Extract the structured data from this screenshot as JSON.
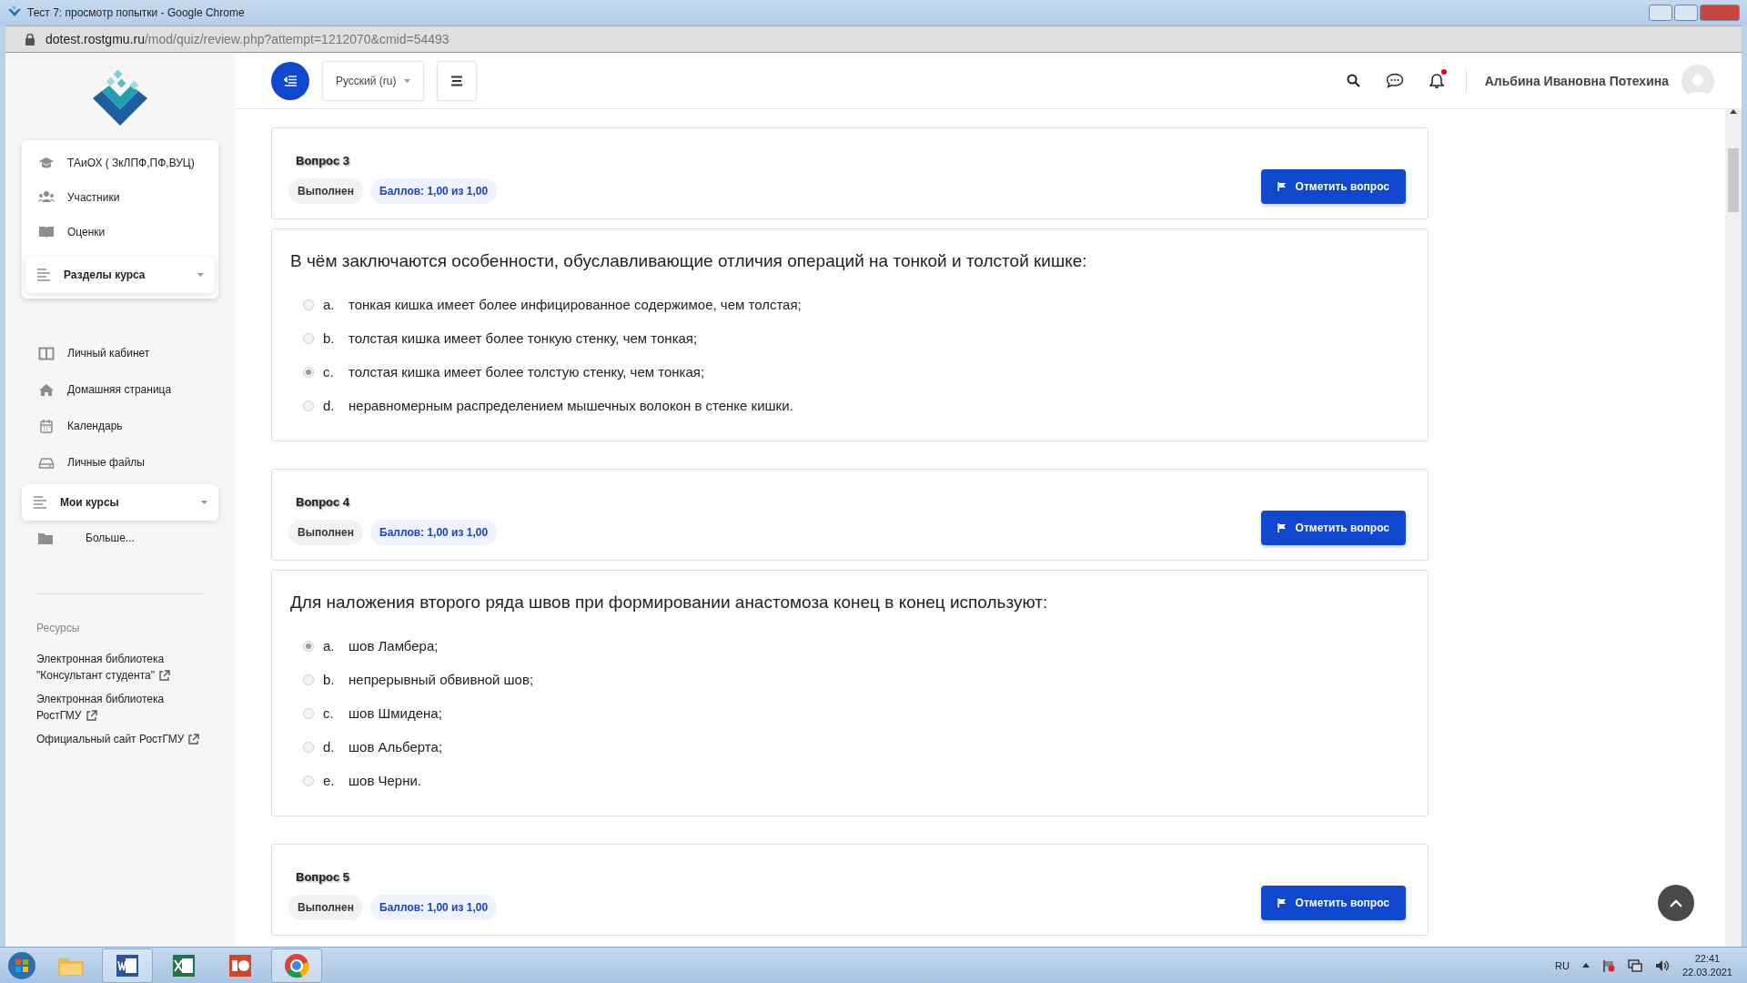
{
  "window": {
    "title": "Тест 7: просмотр попытки - Google Chrome"
  },
  "address_bar": {
    "host": "dotest.rostgmu.ru",
    "path": "/mod/quiz/review.php?attempt=1212070&cmid=54493"
  },
  "header": {
    "language": "Русский (ru)",
    "user_name": "Альбина Ивановна Потехина",
    "notification_unread": true
  },
  "sidebar": {
    "course_menu": [
      {
        "label": "ТАиОХ ( ЗкЛПФ,ПФ,ВУЦ)"
      },
      {
        "label": "Участники"
      },
      {
        "label": "Оценки"
      }
    ],
    "course_sections": {
      "label": "Разделы курса",
      "expanded": false
    },
    "nav": [
      {
        "label": "Личный кабинет"
      },
      {
        "label": "Домашняя страница"
      },
      {
        "label": "Календарь"
      },
      {
        "label": "Личные файлы"
      }
    ],
    "my_courses": {
      "label": "Мои курсы",
      "expanded": false
    },
    "more": {
      "label": "Больше..."
    },
    "resources": {
      "heading": "Ресурсы",
      "links": [
        "Электронная библиотека \"Консультант студента\"",
        "Электронная библиотека РостГМУ",
        "Официальный сайт РостГМУ"
      ]
    }
  },
  "questions": [
    {
      "title": "Вопрос 3",
      "status": "Выполнен",
      "score": "Баллов: 1,00 из 1,00",
      "flag_button": "Отметить вопрос",
      "text": "В чём заключаются особенности, обуславливающие отличия операций на тонкой и толстой кишке:",
      "options": [
        {
          "letter": "a.",
          "text": "тонкая кишка имеет более инфицированное содержимое, чем толстая;",
          "selected": false
        },
        {
          "letter": "b.",
          "text": "толстая кишка имеет более тонкую стенку, чем тонкая;",
          "selected": false
        },
        {
          "letter": "c.",
          "text": "толстая кишка имеет более толстую стенку, чем тонкая;",
          "selected": true
        },
        {
          "letter": "d.",
          "text": "неравномерным распределением мышечных волокон в стенке кишки.",
          "selected": false
        }
      ]
    },
    {
      "title": "Вопрос 4",
      "status": "Выполнен",
      "score": "Баллов: 1,00 из 1,00",
      "flag_button": "Отметить вопрос",
      "text": "Для наложения второго ряда швов при формировании анастомоза конец в конец используют:",
      "options": [
        {
          "letter": "a.",
          "text": "шов Ламбера;",
          "selected": true
        },
        {
          "letter": "b.",
          "text": "непрерывный обвивной шов;",
          "selected": false
        },
        {
          "letter": "c.",
          "text": "шов Шмидена;",
          "selected": false
        },
        {
          "letter": "d.",
          "text": "шов Альберта;",
          "selected": false
        },
        {
          "letter": "e.",
          "text": "шов Черни.",
          "selected": false
        }
      ]
    },
    {
      "title": "Вопрос 5",
      "status": "Выполнен",
      "score": "Баллов: 1,00 из 1,00",
      "flag_button": "Отметить вопрос"
    }
  ],
  "taskbar": {
    "language": "RU",
    "time": "22:41",
    "date": "22.03.2021"
  }
}
